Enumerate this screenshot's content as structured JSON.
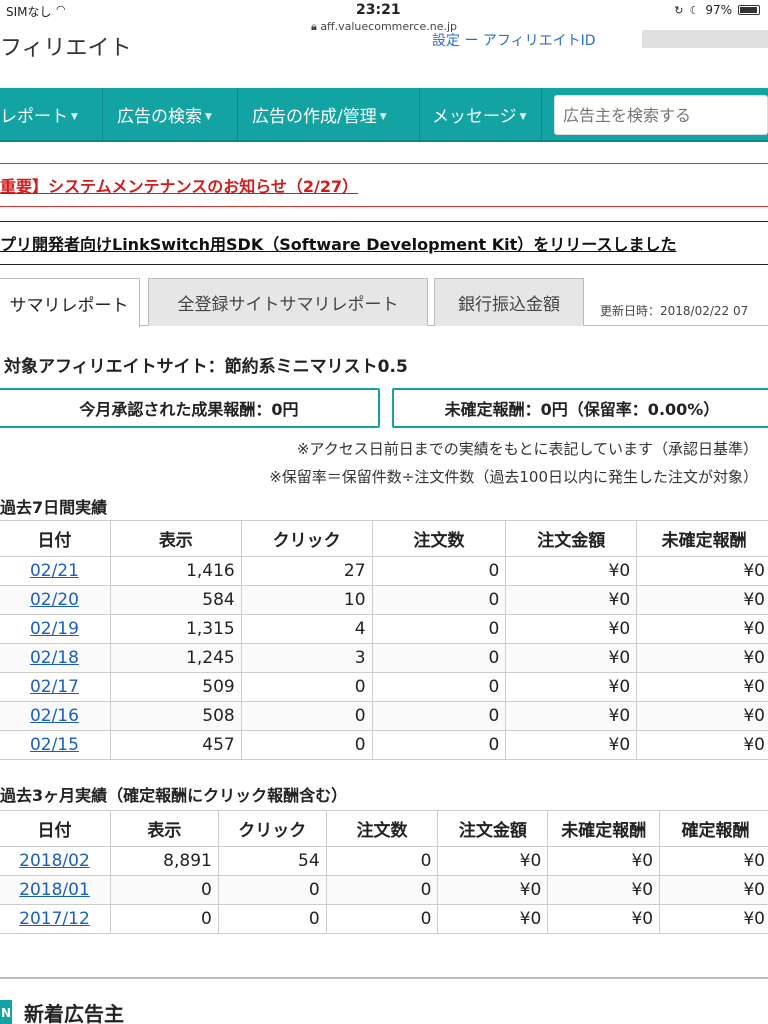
{
  "status": {
    "carrier": "SIMなし",
    "time": "23:21",
    "battery": "97%",
    "url": "aff.valuecommerce.ne.jp"
  },
  "header": {
    "brand": "フィリエイト",
    "right_text": "設定 ー アフィリエイトID"
  },
  "nav": {
    "items": [
      "レポート",
      "広告の検索",
      "広告の作成/管理",
      "メッセージ"
    ],
    "search_placeholder": "広告主を検索する"
  },
  "notices": {
    "red": "重要】システムメンテナンスのお知らせ（2/27）",
    "black": "プリ開発者向けLinkSwitch用SDK（Software Development Kit）をリリースしました"
  },
  "tabs": [
    "サマリレポート",
    "全登録サイトサマリレポート",
    "銀行振込金額"
  ],
  "updated": "更新日時：2018/02/22 07",
  "site_title": "対象アフィリエイトサイト：節約系ミニマリスト0.5",
  "boxes": {
    "approved": "今月承認された成果報酬：0円",
    "pending": "未確定報酬：0円（保留率：0.00%）"
  },
  "notes": [
    "※アクセス日前日までの実績をもとに表記しています（承認日基準）",
    "※保留率＝保留件数÷注文件数（過去100日以内に発生した注文が対象）"
  ],
  "weekly": {
    "title": "過去7日間実績",
    "headers": [
      "日付",
      "表示",
      "クリック",
      "注文数",
      "注文金額",
      "未確定報酬"
    ],
    "rows": [
      [
        "02/21",
        "1,416",
        "27",
        "0",
        "¥0",
        "¥0"
      ],
      [
        "02/20",
        "584",
        "10",
        "0",
        "¥0",
        "¥0"
      ],
      [
        "02/19",
        "1,315",
        "4",
        "0",
        "¥0",
        "¥0"
      ],
      [
        "02/18",
        "1,245",
        "3",
        "0",
        "¥0",
        "¥0"
      ],
      [
        "02/17",
        "509",
        "0",
        "0",
        "¥0",
        "¥0"
      ],
      [
        "02/16",
        "508",
        "0",
        "0",
        "¥0",
        "¥0"
      ],
      [
        "02/15",
        "457",
        "0",
        "0",
        "¥0",
        "¥0"
      ]
    ]
  },
  "monthly": {
    "title": "過去3ヶ月実績（確定報酬にクリック報酬含む）",
    "headers": [
      "日付",
      "表示",
      "クリック",
      "注文数",
      "注文金額",
      "未確定報酬",
      "確定報酬"
    ],
    "rows": [
      [
        "2018/02",
        "8,891",
        "54",
        "0",
        "¥0",
        "¥0",
        "¥0"
      ],
      [
        "2018/01",
        "0",
        "0",
        "0",
        "¥0",
        "¥0",
        "¥0"
      ],
      [
        "2017/12",
        "0",
        "0",
        "0",
        "¥0",
        "¥0",
        "¥0"
      ]
    ]
  },
  "new_advertisers": {
    "icon": "N",
    "label": "新着広告主"
  }
}
